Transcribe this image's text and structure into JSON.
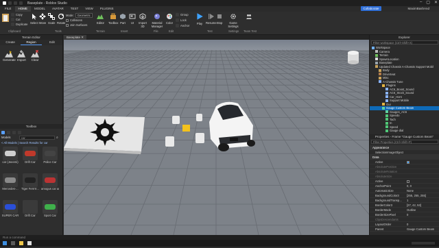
{
  "titlebar": {
    "title": "Baseplate - Roblox Studio",
    "controls": [
      "–",
      "▢",
      "✕"
    ]
  },
  "menubar": {
    "items": [
      "FILE",
      "HOME",
      "MODEL",
      "AVATAR",
      "TEST",
      "VIEW",
      "PLUGINS"
    ],
    "active_index": 1,
    "collaborate": "Collaborate",
    "username": "MaximBashAnd"
  },
  "ribbon": {
    "clipboard": {
      "copy": "Copy",
      "cut": "Cut",
      "duplicate": "Duplicate",
      "label": "Clipboard"
    },
    "tools": {
      "select": "Select",
      "move": "Move",
      "scale": "Scale",
      "rotate": "Rotate",
      "label": "Tools"
    },
    "mode": {
      "label": "Mode:",
      "value": "Geometric"
    },
    "collisions": "Collisions",
    "join_surfaces": "Join Surfaces",
    "terrain": {
      "editor": "Editor",
      "label": "Terrain"
    },
    "insert": {
      "toolbox": "Toolbox",
      "part": "Part",
      "ui": "UI",
      "import3d": "Import 3D",
      "label": "Insert"
    },
    "file": {
      "material": "Material Manager",
      "label": "File"
    },
    "edit": {
      "color": "Color",
      "group": "Group",
      "lock": "Lock",
      "anchor": "Anchor",
      "label": "Edit"
    },
    "test": {
      "play": "Play",
      "resume": "Resume",
      "stop": "Stop",
      "label": "Test"
    },
    "settings": {
      "game_settings": "Game Settings",
      "label": "Settings"
    },
    "team_test": {
      "team_test": "Team Test",
      "label": "Team Test"
    }
  },
  "toolbox": {
    "title": "Terrain Editor",
    "tabs": [
      "Create",
      "Region",
      "Edit"
    ],
    "tools": [
      "Generate",
      "Import",
      "Clear"
    ]
  },
  "doc_tab": {
    "label": "Baseplate"
  },
  "marketplace": {
    "title": "Toolbox",
    "category": "Models",
    "search_value": "car",
    "breadcrumb": "< All Models | Search Results for car",
    "items": [
      {
        "label": "car (Jeeemi)"
      },
      {
        "label": "Drift Car"
      },
      {
        "label": "Police Car"
      },
      {
        "label": "Mercedes-..."
      },
      {
        "label": "Tiger Ferrrrr..."
      },
      {
        "label": "amogus car among us..."
      },
      {
        "label": "SUPER CAR"
      },
      {
        "label": "Drift Car"
      },
      {
        "label": "Sport Car"
      }
    ]
  },
  "explorer": {
    "title": "Explorer",
    "filter": "Filter workspace (Ctrl+Shift+X)",
    "rows": [
      {
        "label": "Workspace",
        "depth": 0,
        "icon": "workspace-icon"
      },
      {
        "label": "Camera",
        "depth": 1,
        "icon": "camera-icon"
      },
      {
        "label": "Terrain",
        "depth": 1,
        "icon": "terrain-icon"
      },
      {
        "label": "SpawnLocation",
        "depth": 1,
        "icon": "spawn-icon"
      },
      {
        "label": "Baseplate",
        "depth": 1,
        "icon": "part-icon"
      },
      {
        "label": "Updated Chassis A-Chassis Support Mobil",
        "depth": 1,
        "icon": "model-icon"
      },
      {
        "label": "Body",
        "depth": 2,
        "icon": "model-icon"
      },
      {
        "label": "DriveSeat",
        "depth": 2,
        "icon": "seat-icon"
      },
      {
        "label": "Misc",
        "depth": 2,
        "icon": "model-icon"
      },
      {
        "label": "A-Chassis Tune",
        "depth": 2,
        "icon": "script-icon"
      },
      {
        "label": "Plugins",
        "depth": 3,
        "icon": "folder-icon"
      },
      {
        "label": "AC6_Boost_Sound",
        "depth": 4,
        "icon": "script-icon"
      },
      {
        "label": "AC6_Stock_Sound",
        "depth": 4,
        "icon": "script-icon"
      },
      {
        "label": "Car_Horn",
        "depth": 4,
        "icon": "script-icon"
      },
      {
        "label": "Support Mobile",
        "depth": 4,
        "icon": "script-icon"
      },
      {
        "label": "Gui",
        "depth": 3,
        "icon": "folder-icon"
      },
      {
        "label": "Gauge Custom Beam",
        "depth": 3,
        "icon": "gui-icon",
        "selected": true
      },
      {
        "label": "Gauges_AC6",
        "depth": 4,
        "icon": "gui-icon"
      },
      {
        "label": "Speedo",
        "depth": 4,
        "icon": "frame-icon"
      },
      {
        "label": "Tach",
        "depth": 4,
        "icon": "frame-icon"
      },
      {
        "label": "In",
        "depth": 4,
        "icon": "frame-icon"
      },
      {
        "label": "Speed",
        "depth": 4,
        "icon": "frame-icon"
      },
      {
        "label": "Gauge dial",
        "depth": 4,
        "icon": "frame-icon"
      }
    ]
  },
  "properties": {
    "title": "Properties - Frame \"Gauge Custom Beam\"",
    "filter": "Filter Properties (Ctrl+Shift+P)",
    "sections": [
      {
        "name": "Appearance",
        "rows": [
          {
            "k": "SelectionImageObject",
            "v": ""
          }
        ]
      },
      {
        "name": "Data",
        "rows": [
          {
            "k": "Active",
            "v": "checkbox-checked"
          },
          {
            "k": "AbsolutePosition",
            "v": "",
            "dim": true
          },
          {
            "k": "AbsoluteRotation",
            "v": "",
            "dim": true
          },
          {
            "k": "AbsoluteSize",
            "v": "",
            "dim": true
          },
          {
            "k": "Active",
            "v": "checkbox-unchecked"
          },
          {
            "k": "AnchorPoint",
            "v": "0, 0"
          },
          {
            "k": "AutomaticSize",
            "v": "None"
          },
          {
            "k": "BackgroundColor3",
            "v": "[255, 255, 255]"
          },
          {
            "k": "BackgroundTransp...",
            "v": "1"
          },
          {
            "k": "BorderColor3",
            "v": "[27, 42, 53]"
          },
          {
            "k": "BorderMode",
            "v": "Outline"
          },
          {
            "k": "BorderSizePixel",
            "v": "0"
          },
          {
            "k": "ClipsDescendants",
            "v": "",
            "dim": true
          },
          {
            "k": "LayoutOrder",
            "v": "0"
          },
          {
            "k": "Parent",
            "v": "Gauge Custom Beam"
          }
        ]
      }
    ]
  },
  "command_bar": {
    "placeholder": "Run a command"
  },
  "viewport": {
    "tiles": 7,
    "colors": {
      "sky": "#3c434f",
      "ground": "#7b7f85",
      "grid": "#5c6067",
      "car": "#f1f1f1",
      "accent": "#f3c21c"
    }
  }
}
